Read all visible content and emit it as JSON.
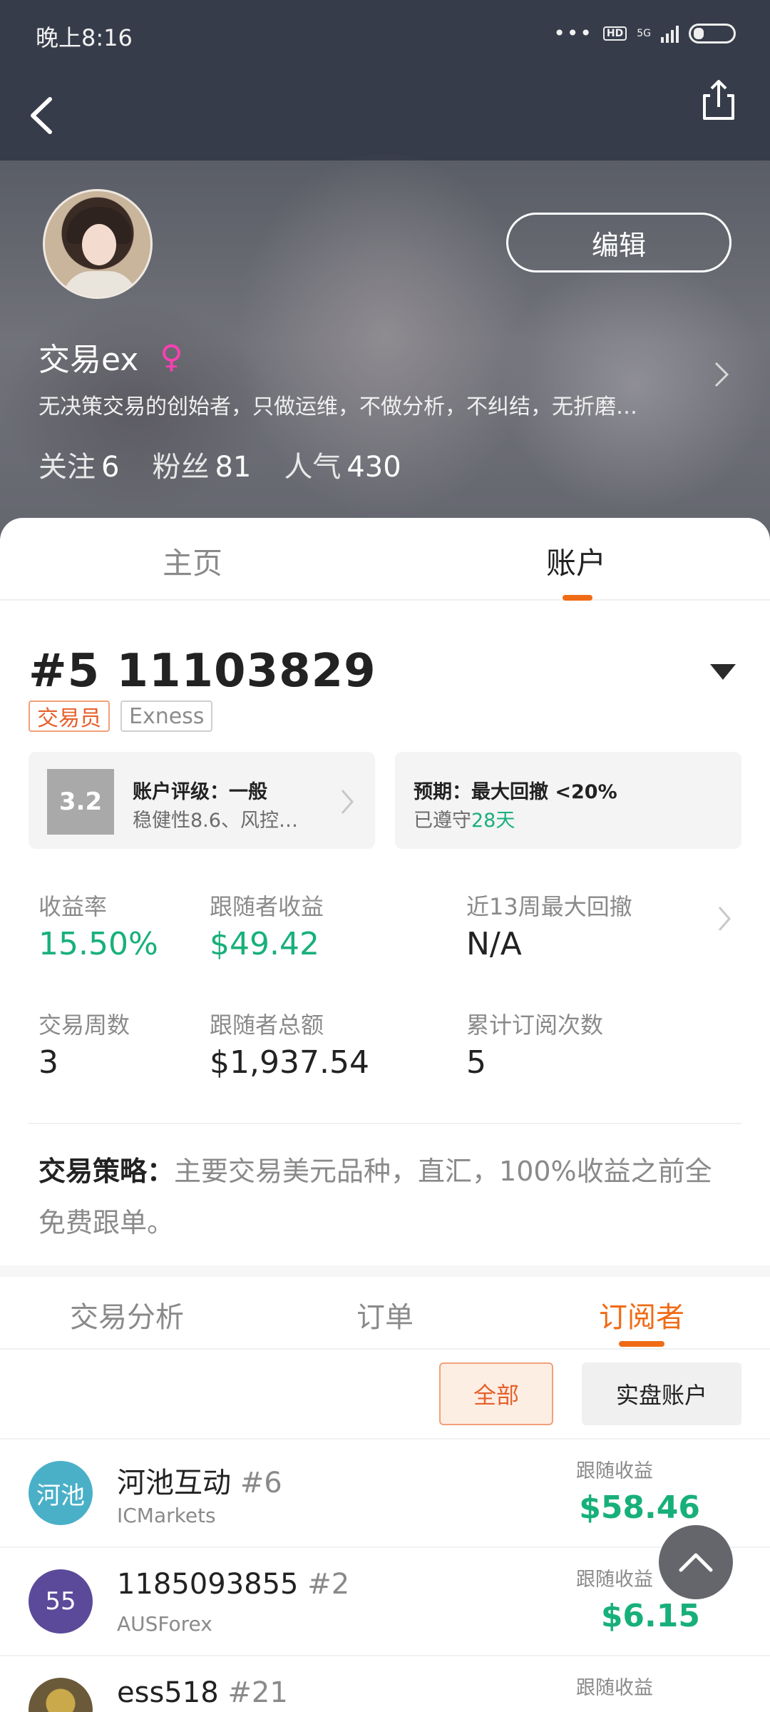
{
  "status_bar": {
    "time": "晚上8:16",
    "dots": "•••",
    "hd": "HD",
    "net": "5G"
  },
  "profile": {
    "name": "交易ex",
    "gender_symbol": "♀",
    "bio": "无决策交易的创始者，只做运维，不做分析，不纠结，无折磨…",
    "edit_label": "编辑",
    "stats": [
      {
        "label": "关注",
        "value": "6"
      },
      {
        "label": "粉丝",
        "value": "81"
      },
      {
        "label": "人气",
        "value": "430"
      }
    ]
  },
  "main_tabs": [
    {
      "label": "主页",
      "active": false
    },
    {
      "label": "账户",
      "active": true
    }
  ],
  "account": {
    "id": "#5 11103829",
    "tags": {
      "trader": "交易员",
      "broker": "Exness"
    },
    "rating": {
      "score": "3.2",
      "title": "账户评级：一般",
      "subtitle": "稳健性8.6、风控…"
    },
    "expectation": {
      "title": "预期：最大回撤 <20%",
      "complied_prefix": "已遵守",
      "complied_days": "28天"
    },
    "metrics": {
      "return_rate": {
        "label": "收益率",
        "value": "15.50%"
      },
      "follower_profit": {
        "label": "跟随者收益",
        "value": "$49.42"
      },
      "max_drawdown": {
        "label": "近13周最大回撤",
        "value": "N/A"
      },
      "trading_weeks": {
        "label": "交易周数",
        "value": "3"
      },
      "follower_total": {
        "label": "跟随者总额",
        "value": "$1,937.54"
      },
      "subscriptions": {
        "label": "累计订阅次数",
        "value": "5"
      }
    },
    "strategy": {
      "label": "交易策略：",
      "text": "主要交易美元品种，直汇，100%收益之前全免费跟单。"
    }
  },
  "sub_tabs": [
    {
      "label": "交易分析",
      "active": false
    },
    {
      "label": "订单",
      "active": false
    },
    {
      "label": "订阅者",
      "active": true
    }
  ],
  "filters": {
    "all": "全部",
    "real": "实盘账户"
  },
  "subscribers": [
    {
      "avatar_text": "河池",
      "avatar_color": "#4ab0c8",
      "name": "河池互动",
      "rank": "#6",
      "broker": "ICMarkets",
      "earn_label": "跟随收益",
      "earn": "$58.46"
    },
    {
      "avatar_text": "55",
      "avatar_color": "#5b4a9a",
      "name": "1185093855",
      "rank": "#2",
      "broker": "AUSForex",
      "earn_label": "跟随收益",
      "earn": "$6.15"
    },
    {
      "avatar_text": "",
      "avatar_color": "#6a5a3a",
      "name": "ess518",
      "rank": "#21",
      "broker": "",
      "earn_label": "跟随收益",
      "earn": ""
    }
  ],
  "colors": {
    "accent": "#f06b16",
    "positive": "#18b07a",
    "header": "#3c4250"
  },
  "icons": [
    "back-arrow-icon",
    "share-icon",
    "chevron-right-icon",
    "dropdown-triangle-icon",
    "scroll-top-icon",
    "female-icon"
  ]
}
